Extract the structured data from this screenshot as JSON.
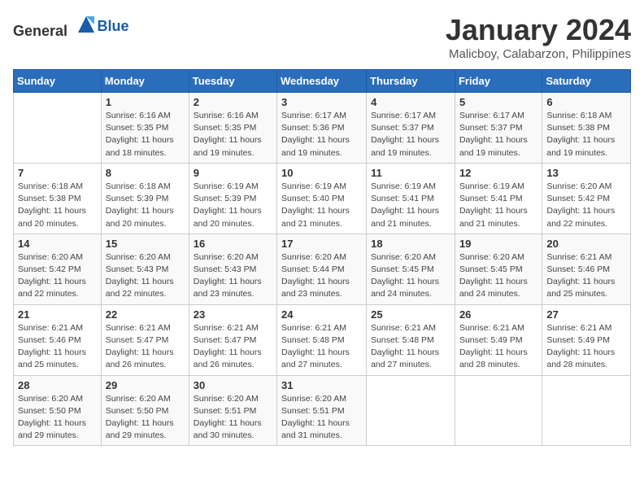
{
  "logo": {
    "general": "General",
    "blue": "Blue"
  },
  "title": "January 2024",
  "subtitle": "Malicboy, Calabarzon, Philippines",
  "days_of_week": [
    "Sunday",
    "Monday",
    "Tuesday",
    "Wednesday",
    "Thursday",
    "Friday",
    "Saturday"
  ],
  "weeks": [
    [
      {
        "day": "",
        "sunrise": "",
        "sunset": "",
        "daylight": ""
      },
      {
        "day": "1",
        "sunrise": "Sunrise: 6:16 AM",
        "sunset": "Sunset: 5:35 PM",
        "daylight": "Daylight: 11 hours and 18 minutes."
      },
      {
        "day": "2",
        "sunrise": "Sunrise: 6:16 AM",
        "sunset": "Sunset: 5:35 PM",
        "daylight": "Daylight: 11 hours and 19 minutes."
      },
      {
        "day": "3",
        "sunrise": "Sunrise: 6:17 AM",
        "sunset": "Sunset: 5:36 PM",
        "daylight": "Daylight: 11 hours and 19 minutes."
      },
      {
        "day": "4",
        "sunrise": "Sunrise: 6:17 AM",
        "sunset": "Sunset: 5:37 PM",
        "daylight": "Daylight: 11 hours and 19 minutes."
      },
      {
        "day": "5",
        "sunrise": "Sunrise: 6:17 AM",
        "sunset": "Sunset: 5:37 PM",
        "daylight": "Daylight: 11 hours and 19 minutes."
      },
      {
        "day": "6",
        "sunrise": "Sunrise: 6:18 AM",
        "sunset": "Sunset: 5:38 PM",
        "daylight": "Daylight: 11 hours and 19 minutes."
      }
    ],
    [
      {
        "day": "7",
        "sunrise": "Sunrise: 6:18 AM",
        "sunset": "Sunset: 5:38 PM",
        "daylight": "Daylight: 11 hours and 20 minutes."
      },
      {
        "day": "8",
        "sunrise": "Sunrise: 6:18 AM",
        "sunset": "Sunset: 5:39 PM",
        "daylight": "Daylight: 11 hours and 20 minutes."
      },
      {
        "day": "9",
        "sunrise": "Sunrise: 6:19 AM",
        "sunset": "Sunset: 5:39 PM",
        "daylight": "Daylight: 11 hours and 20 minutes."
      },
      {
        "day": "10",
        "sunrise": "Sunrise: 6:19 AM",
        "sunset": "Sunset: 5:40 PM",
        "daylight": "Daylight: 11 hours and 21 minutes."
      },
      {
        "day": "11",
        "sunrise": "Sunrise: 6:19 AM",
        "sunset": "Sunset: 5:41 PM",
        "daylight": "Daylight: 11 hours and 21 minutes."
      },
      {
        "day": "12",
        "sunrise": "Sunrise: 6:19 AM",
        "sunset": "Sunset: 5:41 PM",
        "daylight": "Daylight: 11 hours and 21 minutes."
      },
      {
        "day": "13",
        "sunrise": "Sunrise: 6:20 AM",
        "sunset": "Sunset: 5:42 PM",
        "daylight": "Daylight: 11 hours and 22 minutes."
      }
    ],
    [
      {
        "day": "14",
        "sunrise": "Sunrise: 6:20 AM",
        "sunset": "Sunset: 5:42 PM",
        "daylight": "Daylight: 11 hours and 22 minutes."
      },
      {
        "day": "15",
        "sunrise": "Sunrise: 6:20 AM",
        "sunset": "Sunset: 5:43 PM",
        "daylight": "Daylight: 11 hours and 22 minutes."
      },
      {
        "day": "16",
        "sunrise": "Sunrise: 6:20 AM",
        "sunset": "Sunset: 5:43 PM",
        "daylight": "Daylight: 11 hours and 23 minutes."
      },
      {
        "day": "17",
        "sunrise": "Sunrise: 6:20 AM",
        "sunset": "Sunset: 5:44 PM",
        "daylight": "Daylight: 11 hours and 23 minutes."
      },
      {
        "day": "18",
        "sunrise": "Sunrise: 6:20 AM",
        "sunset": "Sunset: 5:45 PM",
        "daylight": "Daylight: 11 hours and 24 minutes."
      },
      {
        "day": "19",
        "sunrise": "Sunrise: 6:20 AM",
        "sunset": "Sunset: 5:45 PM",
        "daylight": "Daylight: 11 hours and 24 minutes."
      },
      {
        "day": "20",
        "sunrise": "Sunrise: 6:21 AM",
        "sunset": "Sunset: 5:46 PM",
        "daylight": "Daylight: 11 hours and 25 minutes."
      }
    ],
    [
      {
        "day": "21",
        "sunrise": "Sunrise: 6:21 AM",
        "sunset": "Sunset: 5:46 PM",
        "daylight": "Daylight: 11 hours and 25 minutes."
      },
      {
        "day": "22",
        "sunrise": "Sunrise: 6:21 AM",
        "sunset": "Sunset: 5:47 PM",
        "daylight": "Daylight: 11 hours and 26 minutes."
      },
      {
        "day": "23",
        "sunrise": "Sunrise: 6:21 AM",
        "sunset": "Sunset: 5:47 PM",
        "daylight": "Daylight: 11 hours and 26 minutes."
      },
      {
        "day": "24",
        "sunrise": "Sunrise: 6:21 AM",
        "sunset": "Sunset: 5:48 PM",
        "daylight": "Daylight: 11 hours and 27 minutes."
      },
      {
        "day": "25",
        "sunrise": "Sunrise: 6:21 AM",
        "sunset": "Sunset: 5:48 PM",
        "daylight": "Daylight: 11 hours and 27 minutes."
      },
      {
        "day": "26",
        "sunrise": "Sunrise: 6:21 AM",
        "sunset": "Sunset: 5:49 PM",
        "daylight": "Daylight: 11 hours and 28 minutes."
      },
      {
        "day": "27",
        "sunrise": "Sunrise: 6:21 AM",
        "sunset": "Sunset: 5:49 PM",
        "daylight": "Daylight: 11 hours and 28 minutes."
      }
    ],
    [
      {
        "day": "28",
        "sunrise": "Sunrise: 6:20 AM",
        "sunset": "Sunset: 5:50 PM",
        "daylight": "Daylight: 11 hours and 29 minutes."
      },
      {
        "day": "29",
        "sunrise": "Sunrise: 6:20 AM",
        "sunset": "Sunset: 5:50 PM",
        "daylight": "Daylight: 11 hours and 29 minutes."
      },
      {
        "day": "30",
        "sunrise": "Sunrise: 6:20 AM",
        "sunset": "Sunset: 5:51 PM",
        "daylight": "Daylight: 11 hours and 30 minutes."
      },
      {
        "day": "31",
        "sunrise": "Sunrise: 6:20 AM",
        "sunset": "Sunset: 5:51 PM",
        "daylight": "Daylight: 11 hours and 31 minutes."
      },
      {
        "day": "",
        "sunrise": "",
        "sunset": "",
        "daylight": ""
      },
      {
        "day": "",
        "sunrise": "",
        "sunset": "",
        "daylight": ""
      },
      {
        "day": "",
        "sunrise": "",
        "sunset": "",
        "daylight": ""
      }
    ]
  ]
}
